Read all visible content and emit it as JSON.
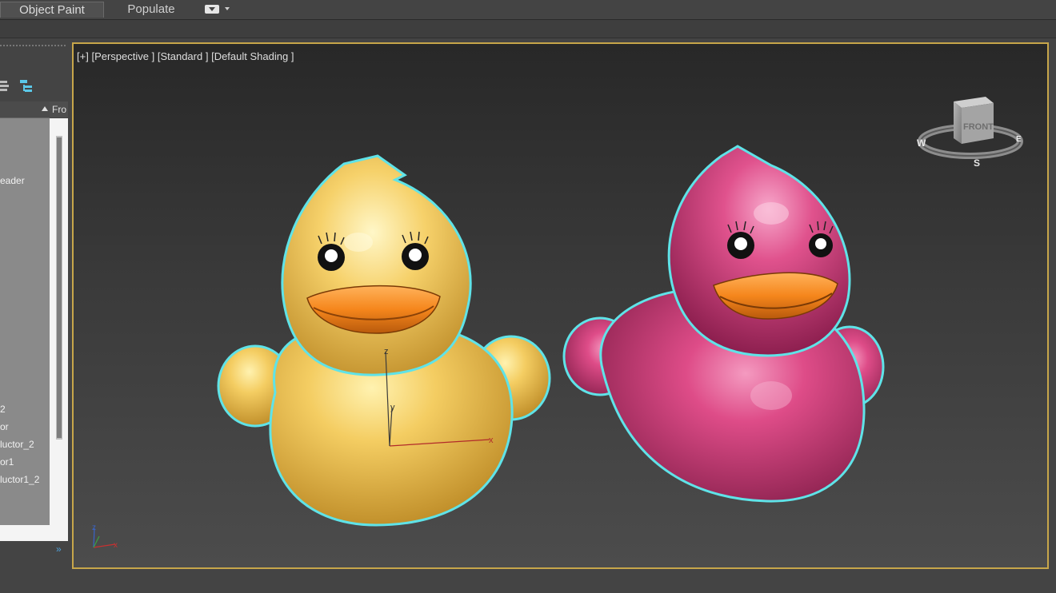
{
  "ribbon": {
    "tabs": [
      {
        "label": "Object Paint"
      },
      {
        "label": "Populate"
      }
    ]
  },
  "scene_explorer": {
    "second_column_header": "Fro",
    "rows": [
      {
        "label": "eader"
      },
      {
        "label": "2"
      },
      {
        "label": "or"
      },
      {
        "label": "luctor_2"
      },
      {
        "label": "or1"
      },
      {
        "label": "luctor1_2"
      }
    ]
  },
  "viewport": {
    "menu_plus": "[+]",
    "view_name": "[Perspective ]",
    "preset": "[Standard ]",
    "shading": "[Default Shading ]",
    "viewcube": {
      "face_label": "FRONT",
      "compass": {
        "west": "W",
        "south": "S",
        "east": "E"
      }
    },
    "gizmo_axes": {
      "x": "x",
      "y": "y",
      "z": "z"
    },
    "world_axes": {
      "x": "x",
      "z": "z"
    }
  },
  "colors": {
    "selection_outline": "#5fe3e8",
    "viewport_border": "#c7a64a",
    "duck_yellow": "#f2c95c",
    "duck_pink": "#d94480",
    "beak_orange": "#f5871e"
  }
}
